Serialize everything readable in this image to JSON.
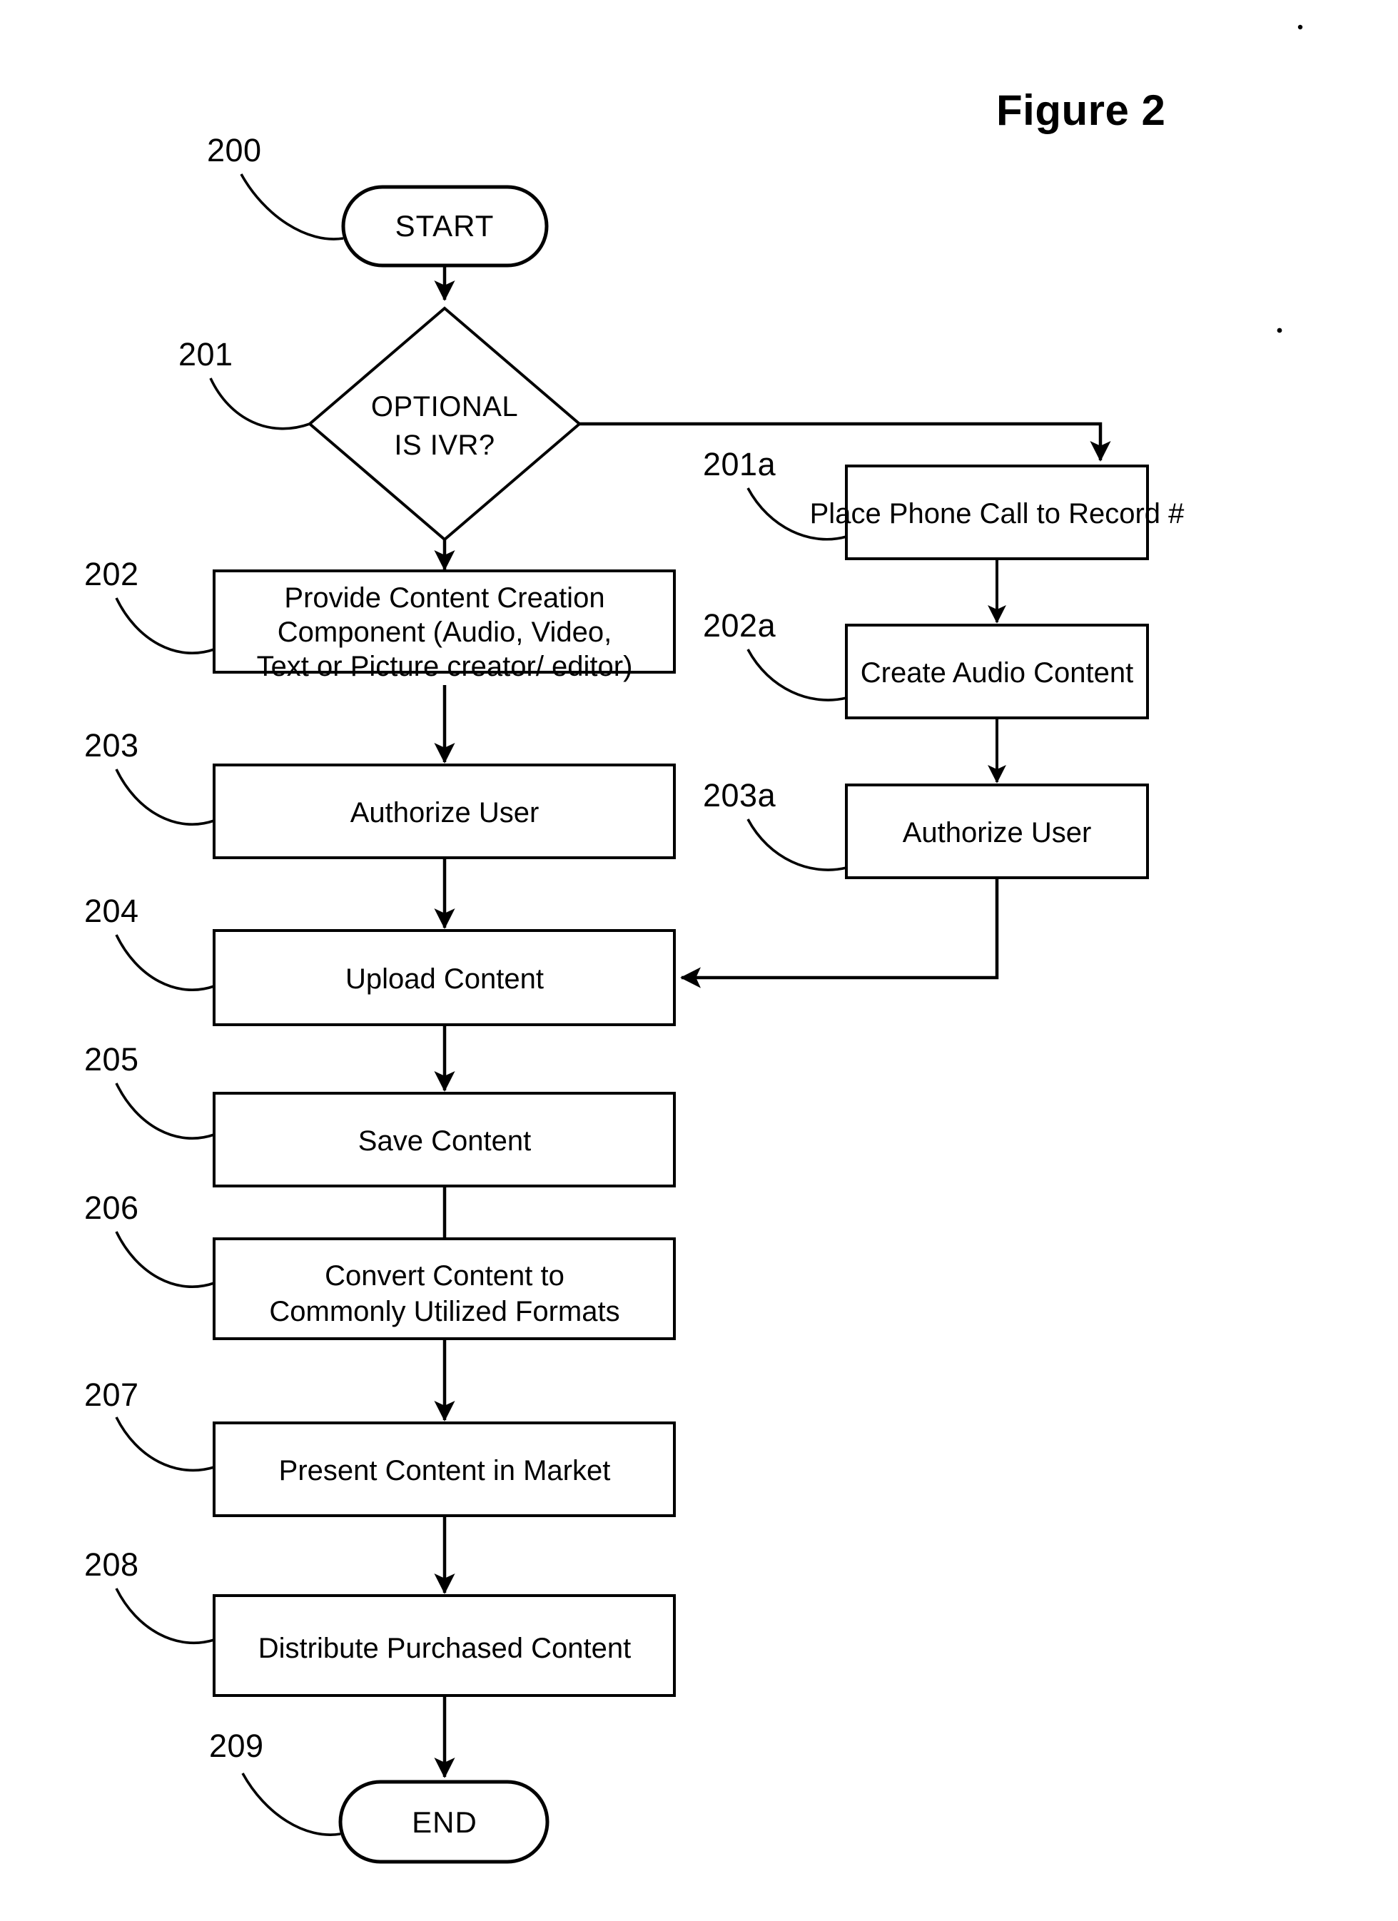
{
  "figure": {
    "title": "Figure 2",
    "type": "process-flowchart"
  },
  "diagram_data": {
    "type": "flowchart",
    "title": "Figure 2",
    "nodes": [
      {
        "ref": "200",
        "label": "START",
        "shape": "terminator",
        "column": "left"
      },
      {
        "ref": "201",
        "label": "OPTIONAL IS IVR?",
        "shape": "diamond",
        "column": "left"
      },
      {
        "ref": "202",
        "label": "Provide Content Creation Component (Audio, Video, Text or Picture creator/editor)",
        "shape": "process",
        "column": "left"
      },
      {
        "ref": "203",
        "label": "Authorize User",
        "shape": "process",
        "column": "left"
      },
      {
        "ref": "204",
        "label": "Upload Content",
        "shape": "process",
        "column": "left"
      },
      {
        "ref": "205",
        "label": "Save Content",
        "shape": "process",
        "column": "left"
      },
      {
        "ref": "206",
        "label": "Convert Content to Commonly Utilized Formats",
        "shape": "process",
        "column": "left"
      },
      {
        "ref": "207",
        "label": "Present Content in Market",
        "shape": "process",
        "column": "left"
      },
      {
        "ref": "208",
        "label": "Distribute Purchased Content",
        "shape": "process",
        "column": "left"
      },
      {
        "ref": "209",
        "label": "END",
        "shape": "terminator",
        "column": "left"
      },
      {
        "ref": "201a",
        "label": "Place Phone Call to Record #",
        "shape": "process",
        "column": "right"
      },
      {
        "ref": "202a",
        "label": "Create Audio Content",
        "shape": "process",
        "column": "right"
      },
      {
        "ref": "203a",
        "label": "Authorize User",
        "shape": "process",
        "column": "right"
      }
    ],
    "edges": [
      {
        "from": "200",
        "to": "201",
        "style": "straight-down"
      },
      {
        "from": "201",
        "to": "202",
        "style": "straight-down",
        "branch": "no"
      },
      {
        "from": "201",
        "to": "201a",
        "style": "right-then-down",
        "branch": "yes"
      },
      {
        "from": "201a",
        "to": "202a",
        "style": "straight-down"
      },
      {
        "from": "202a",
        "to": "203a",
        "style": "straight-down"
      },
      {
        "from": "203a",
        "to": "204",
        "style": "down-then-left"
      },
      {
        "from": "202",
        "to": "203",
        "style": "straight-down"
      },
      {
        "from": "203",
        "to": "204",
        "style": "straight-down"
      },
      {
        "from": "204",
        "to": "205",
        "style": "straight-down"
      },
      {
        "from": "205",
        "to": "206",
        "style": "straight-down"
      },
      {
        "from": "206",
        "to": "207",
        "style": "straight-down"
      },
      {
        "from": "207",
        "to": "208",
        "style": "straight-down"
      },
      {
        "from": "208",
        "to": "209",
        "style": "straight-down"
      }
    ],
    "colors": {
      "stroke": "#000000",
      "fill": "#ffffff",
      "text": "#000000"
    }
  },
  "nodes": {
    "n200": {
      "ref": "200",
      "label": "START"
    },
    "n201": {
      "ref": "201",
      "line1": "OPTIONAL",
      "line2": "IS IVR?"
    },
    "n202": {
      "ref": "202",
      "line1": "Provide Content Creation",
      "line2": "Component (Audio, Video,",
      "line3": "Text or Picture creator/ editor)"
    },
    "n203": {
      "ref": "203",
      "label": "Authorize User"
    },
    "n204": {
      "ref": "204",
      "label": "Upload Content"
    },
    "n205": {
      "ref": "205",
      "label": "Save Content"
    },
    "n206": {
      "ref": "206",
      "line1": "Convert Content to",
      "line2": "Commonly Utilized Formats"
    },
    "n207": {
      "ref": "207",
      "label": "Present Content in Market"
    },
    "n208": {
      "ref": "208",
      "label": "Distribute Purchased  Content"
    },
    "n209": {
      "ref": "209",
      "label": "END"
    },
    "n201a": {
      "ref": "201a",
      "label": "Place Phone Call to Record #"
    },
    "n202a": {
      "ref": "202a",
      "label": "Create Audio Content"
    },
    "n203a": {
      "ref": "203a",
      "label": "Authorize User"
    }
  }
}
